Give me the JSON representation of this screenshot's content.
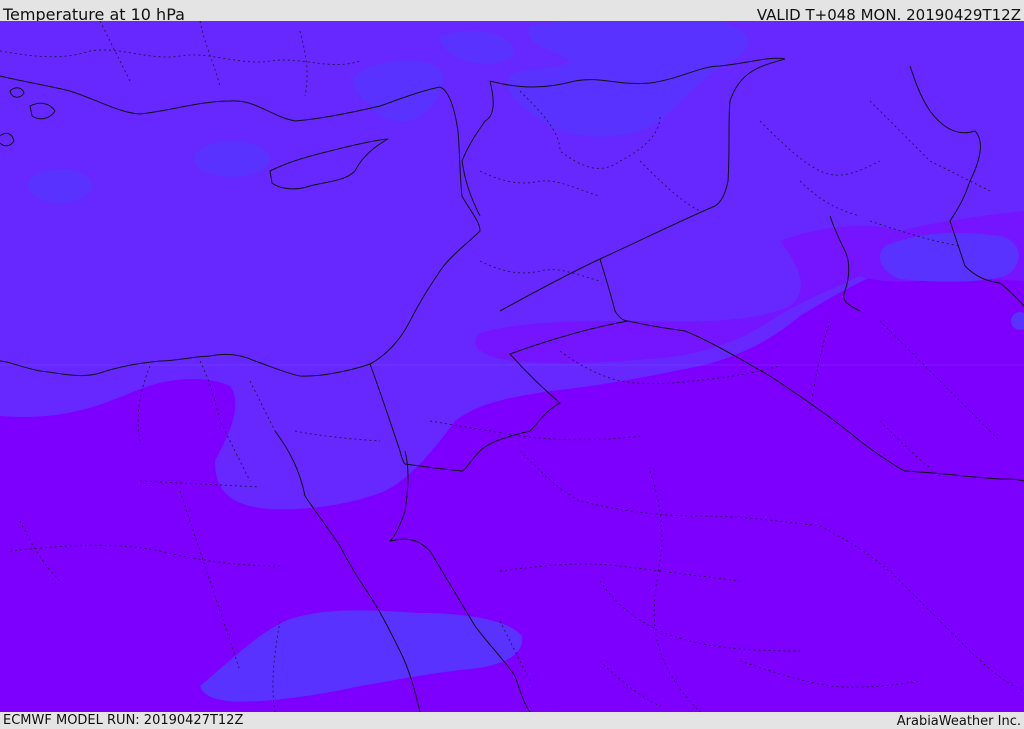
{
  "header": {
    "title": "Temperature at 10 hPa",
    "valid": "VALID T+048 MON. 20190429T12Z"
  },
  "footer": {
    "model_run": "ECMWF MODEL RUN: 20190427T12Z",
    "credit": "ArabiaWeather Inc."
  },
  "map": {
    "field": "Temperature at 10 hPa",
    "colors": {
      "coolest_band": "#5a32ff",
      "cool_band": "#6628ff",
      "mid_band": "#7514ff",
      "warm_band": "#7d00ff",
      "border": "#111111"
    }
  }
}
